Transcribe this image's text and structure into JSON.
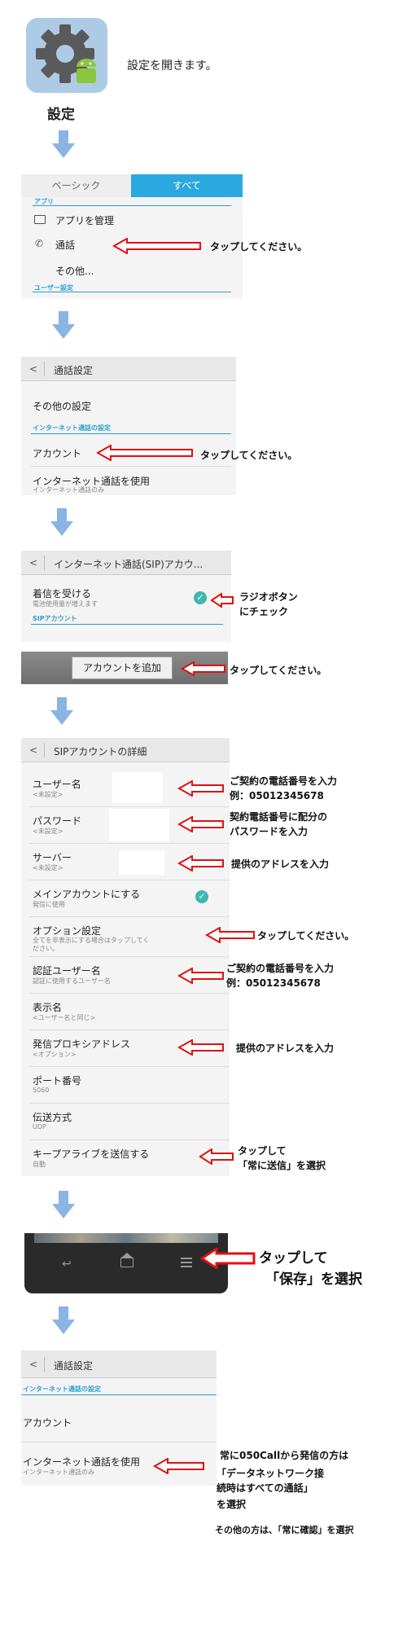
{
  "step1": {
    "app_label": "設定",
    "instruction": "設定を開きます。"
  },
  "step2": {
    "tabs": [
      "ベーシック",
      "すべて"
    ],
    "section_app": "アプリ",
    "item_manage": "アプリを管理",
    "item_call": "通話",
    "item_other": "その他...",
    "section_user": "ユーザー設定",
    "instruction": "タップしてください。"
  },
  "step3": {
    "title": "通話設定",
    "item_other": "その他の設定",
    "section_internet": "インターネット通話の設定",
    "item_account": "アカウント",
    "item_use": "インターネット通話を使用",
    "item_use_sub": "インターネット通話のみ",
    "instruction": "タップしてください。"
  },
  "step4": {
    "title": "インターネット通話(SIP)アカウ...",
    "receive_title": "着信を受ける",
    "receive_sub": "電池使用量が増えます",
    "section_sip": "SIPアカウント",
    "instruction_radio_1": "ラジオボタン",
    "instruction_radio_2": "にチェック",
    "add_button": "アカウントを追加",
    "instruction_add": "タップしてください。"
  },
  "step5": {
    "title": "SIPアカウントの詳細",
    "rows": [
      {
        "title": "ユーザー名",
        "sub": "<未設定>"
      },
      {
        "title": "パスワード",
        "sub": "<未設定>"
      },
      {
        "title": "サーバー",
        "sub": "<未設定>"
      },
      {
        "title": "メインアカウントにする",
        "sub": "発信に使用"
      },
      {
        "title": "オプション設定",
        "sub": "全てを非表示にする場合はタップしてください。"
      },
      {
        "title": "認証ユーザー名",
        "sub": "認証に使用するユーザー名"
      },
      {
        "title": "表示名",
        "sub": "<ユーザー名と同じ>"
      },
      {
        "title": "発信プロキシアドレス",
        "sub": "<オプション>"
      },
      {
        "title": "ポート番号",
        "sub": "5060"
      },
      {
        "title": "伝送方式",
        "sub": "UDP"
      },
      {
        "title": "キープアライブを送信する",
        "sub": "自動"
      }
    ],
    "instr_user_1": "ご契約の電話番号を入力",
    "instr_user_2": "例：05012345678",
    "instr_pass_1": "契約電話番号に配分の",
    "instr_pass_2": "パスワードを入力",
    "instr_server": "提供のアドレスを入力",
    "instr_option": "タップしてください。",
    "instr_auth_1": "ご契約の電話番号を入力",
    "instr_auth_2": "例：05012345678",
    "instr_proxy": "提供のアドレスを入力",
    "instr_keep_1": "タップして",
    "instr_keep_2": "「常に送信」を選択"
  },
  "step6": {
    "instr_1": "タップして",
    "instr_2": "「保存」を選択"
  },
  "step7": {
    "title": "通話設定",
    "section_internet": "インターネット通話の設定",
    "item_account": "アカウント",
    "item_use": "インターネット通話を使用",
    "item_use_sub": "インターネット通話のみ",
    "instr_1": "常に050Callから発信の方は",
    "instr_2": "「データネットワーク接",
    "instr_3": "続時はすべての通話」",
    "instr_4": "を選択",
    "instr_5": "その他の方は、「常に確認」を選択"
  }
}
